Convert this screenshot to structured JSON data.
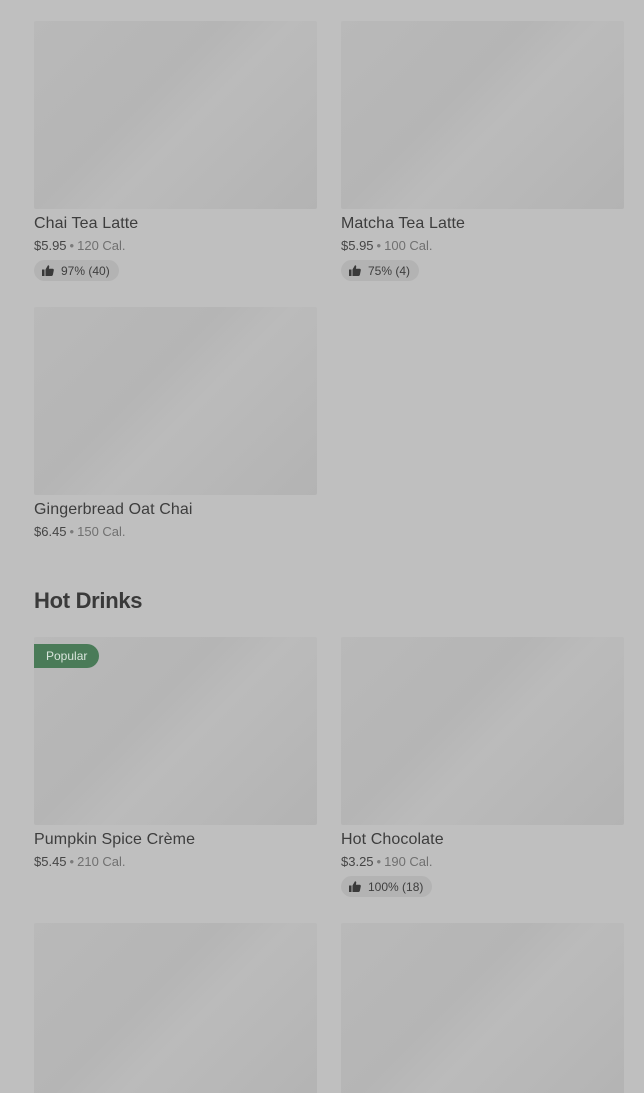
{
  "items": [
    {
      "name": "Chai Tea Latte",
      "price": "$5.95",
      "calories": "120 Cal.",
      "rating": "97% (40)"
    },
    {
      "name": "Matcha Tea Latte",
      "price": "$5.95",
      "calories": "100 Cal.",
      "rating": "75% (4)"
    },
    {
      "name": "Gingerbread Oat Chai",
      "price": "$6.45",
      "calories": "150 Cal."
    }
  ],
  "hot_drinks": {
    "title": "Hot Drinks",
    "items": [
      {
        "name": "Pumpkin Spice Crème",
        "price": "$5.45",
        "calories": "210 Cal.",
        "badge": "Popular"
      },
      {
        "name": "Hot Chocolate",
        "price": "$3.25",
        "calories": "190 Cal.",
        "rating": "100% (18)"
      }
    ]
  },
  "separator": "•",
  "icons": {
    "rating": "thumbs-up-icon"
  }
}
